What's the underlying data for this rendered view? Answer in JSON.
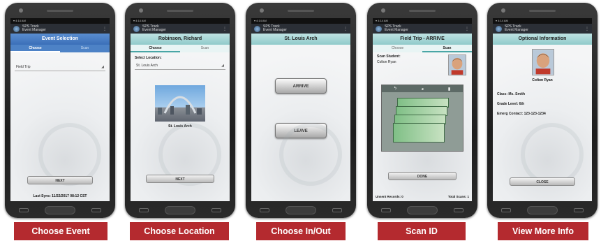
{
  "app": {
    "name": "SPS Track",
    "subtitle": "Event Manager",
    "menu_glyph": "⋮",
    "status_time": "▾ 4:14 AM"
  },
  "screens": [
    {
      "header": "Event Selection",
      "tabs": [
        "Choose",
        "Scan"
      ],
      "field_value": "Field Trip",
      "button": "NEXT",
      "footer": "Last Sync: 11/22/2017 08:12 CST",
      "caption": "Choose Event"
    },
    {
      "header": "Robinson, Richard",
      "tabs": [
        "Choose",
        "Scan"
      ],
      "select_label": "Select Location:",
      "field_value": "St. Louis Arch",
      "photo_caption": "St. Louis Arch",
      "button": "NEXT",
      "caption": "Choose Location"
    },
    {
      "header": "St. Louis Arch",
      "arrive_button": "ARRIVE",
      "leave_button": "LEAVE",
      "caption": "Choose In/Out"
    },
    {
      "header": "Field Trip - ARRIVE",
      "tabs": [
        "Choose",
        "Scan"
      ],
      "scan_label": "Scan Student:",
      "student_name": "Colton Ryan",
      "button": "DONE",
      "unsent": "Unsent Records: 0",
      "total": "Total Scans: 1",
      "caption": "Scan ID"
    },
    {
      "header": "Optional Information",
      "student_name": "Colton Ryan",
      "class_line": "Class: Ms. Smith",
      "grade_line": "Grade Level: 6th",
      "emergency_line": "Emerg Contact: 123-123-1234",
      "button": "CLOSE",
      "caption": "View More Info"
    }
  ],
  "colors": {
    "caption_bg": "#b42a2f",
    "header_teal": "#8fcaca",
    "header_blue": "#3b6fb9"
  }
}
